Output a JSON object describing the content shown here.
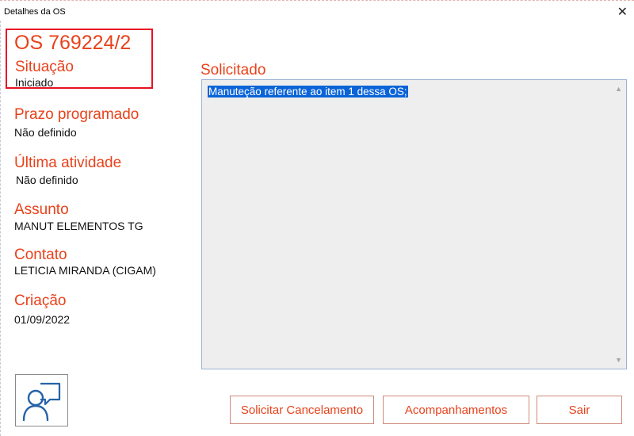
{
  "window": {
    "title": "Detalhes da OS",
    "close_glyph": "✕"
  },
  "os": {
    "number": "OS 769224/2"
  },
  "fields": {
    "situacao": {
      "label": "Situação",
      "value": "Iniciado"
    },
    "prazo": {
      "label": "Prazo programado",
      "value": "Não definido"
    },
    "ultima": {
      "label": "Última atividade",
      "value": "Não definido"
    },
    "assunto": {
      "label": "Assunto",
      "value": "MANUT ELEMENTOS TG"
    },
    "contato": {
      "label": "Contato",
      "value": "LETICIA MIRANDA (CIGAM)"
    },
    "criacao": {
      "label": "Criação",
      "value": "01/09/2022"
    }
  },
  "solicitado": {
    "label": "Solicitado",
    "text": "Manuteção referente ao item 1 dessa OS;"
  },
  "buttons": {
    "cancelar": "Solicitar Cancelamento",
    "acompanhamentos": "Acompanhamentos",
    "sair": "Sair"
  },
  "colors": {
    "accent": "#e8421b",
    "highlight_box": "#e81123",
    "selection": "#0a64d8"
  },
  "icons": {
    "avatar_button": "user-chat-icon"
  }
}
